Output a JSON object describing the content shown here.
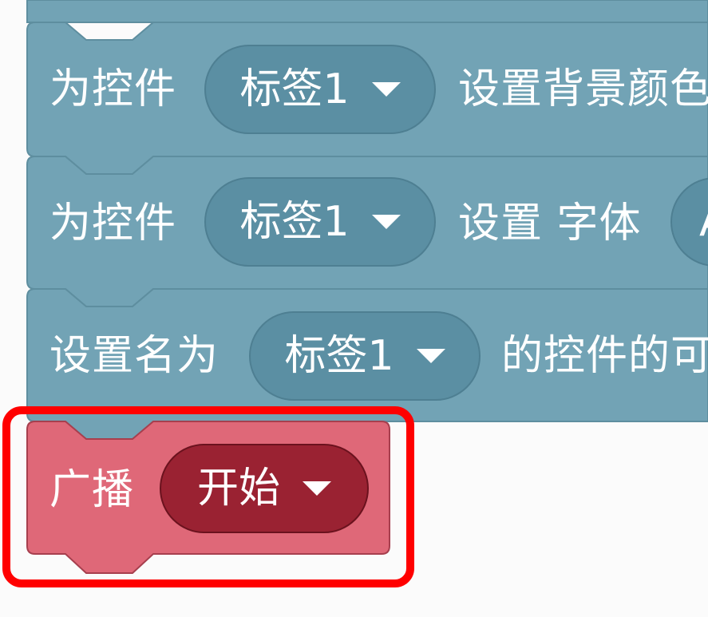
{
  "blocks": [
    {
      "prefix": "为控件",
      "dropdown": "标签1",
      "suffix": "设置背景颜色"
    },
    {
      "prefix": "为控件",
      "dropdown": "标签1",
      "suffix": "设置 字体",
      "trailing_dropdown": "A"
    },
    {
      "prefix": "设置名为",
      "dropdown": "标签1",
      "suffix": "的控件的可"
    }
  ],
  "broadcast_block": {
    "prefix": "广播",
    "dropdown": "开始"
  },
  "colors": {
    "control_block": "#72a3b5",
    "control_block_border": "#5e8e9f",
    "control_dropdown": "#5b8fa3",
    "broadcast_block": "#df6878",
    "broadcast_block_border": "#a73f4e",
    "broadcast_dropdown": "#9a2232",
    "highlight": "#ff0000",
    "background": "#fbfbfb"
  },
  "icons": {
    "dropdown_caret": "caret-down-icon"
  }
}
